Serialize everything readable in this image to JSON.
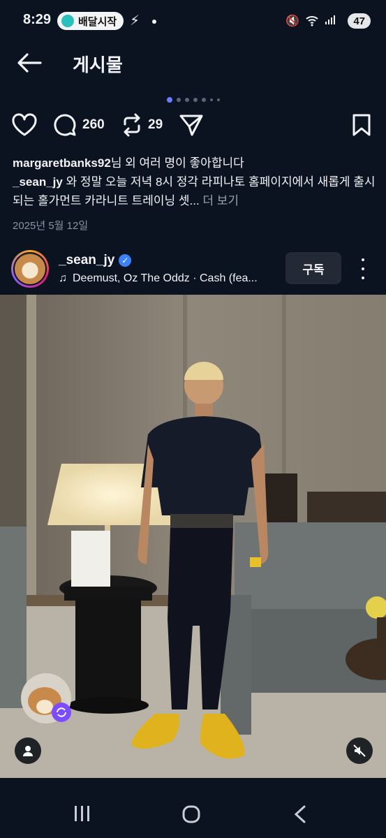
{
  "status_bar": {
    "time": "8:29",
    "notification_app": "배달시작",
    "battery": "47"
  },
  "header": {
    "title": "게시물"
  },
  "post": {
    "likes_count": "260",
    "reposts_count": "29",
    "liked_by_user": "margaretbanks92",
    "liked_by_suffix": "님 외 여러 명이 좋아합니다",
    "caption_username": "_sean_jy",
    "caption_text": " 와 정말 오늘 저녁 8시 정각 라피나토 홈페이지에서 새롭게 출시되는 홀가먼트 카라니트 트레이닝 셋...",
    "more_label": " 더 보기",
    "date": "2025년 5월 12일",
    "author": {
      "username": "_sean_jy",
      "music": "Deemust, Oz The Oddz · Cash (fea..."
    },
    "subscribe_label": "구독"
  },
  "icons": {
    "back": "arrow-left-icon",
    "like": "heart-icon",
    "comment": "comment-icon",
    "repost": "repost-icon",
    "share": "send-icon",
    "save": "bookmark-icon",
    "verified": "verified-badge-icon",
    "music": "music-note-icon",
    "mute": "speaker-muted-icon",
    "tagged_user": "person-icon"
  },
  "colors": {
    "background": "#0b1220",
    "accent": "#6c7bff",
    "verified": "#3b82f6",
    "subscribe_bg": "#232a36"
  }
}
